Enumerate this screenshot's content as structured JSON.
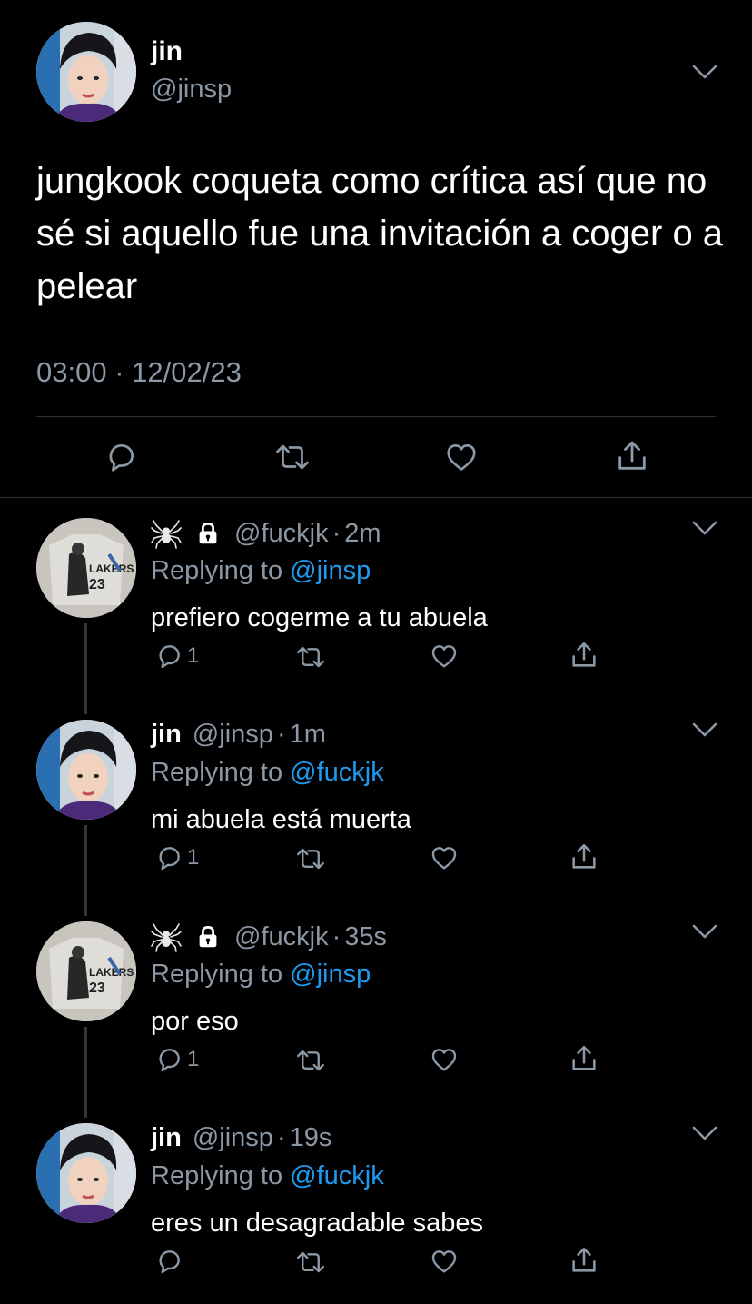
{
  "main_tweet": {
    "name": "jin",
    "handle": "@jinsp",
    "text": "jungkook coqueta como crítica así que no sé si aquello fue una invitación a coger o a pelear",
    "time": "03:00",
    "date": "12/02/23",
    "separator": "·",
    "icons": {
      "more": "chevron-down-icon",
      "reply": "reply-icon",
      "retweet": "retweet-icon",
      "like": "heart-icon",
      "share": "share-icon"
    }
  },
  "replies": [
    {
      "name": "",
      "handle": "@fuckjk",
      "separator": "·",
      "time": "2m",
      "decorations": [
        "spider-icon",
        "lock-icon"
      ],
      "replying_prefix": "Replying to",
      "replying_to": "@jinsp",
      "text": "prefiero cogerme a tu abuela",
      "reply_count": "1",
      "avatar": "shirt-photo"
    },
    {
      "name": "jin",
      "handle": "@jinsp",
      "separator": "·",
      "time": "1m",
      "decorations": [],
      "replying_prefix": "Replying to",
      "replying_to": "@fuckjk",
      "text": "mi abuela está muerta",
      "reply_count": "1",
      "avatar": "person-photo"
    },
    {
      "name": "",
      "handle": "@fuckjk",
      "separator": "·",
      "time": "35s",
      "decorations": [
        "spider-icon",
        "lock-icon"
      ],
      "replying_prefix": "Replying to",
      "replying_to": "@jinsp",
      "text": "por eso",
      "reply_count": "1",
      "avatar": "shirt-photo"
    },
    {
      "name": "jin",
      "handle": "@jinsp",
      "separator": "·",
      "time": "19s",
      "decorations": [],
      "replying_prefix": "Replying to",
      "replying_to": "@fuckjk",
      "text": "eres un desagradable sabes",
      "reply_count": "",
      "avatar": "person-photo"
    }
  ],
  "colors": {
    "background": "#000000",
    "text": "#ffffff",
    "muted": "#8b98a5",
    "link": "#1d9bf0",
    "divider": "#2f3336"
  }
}
